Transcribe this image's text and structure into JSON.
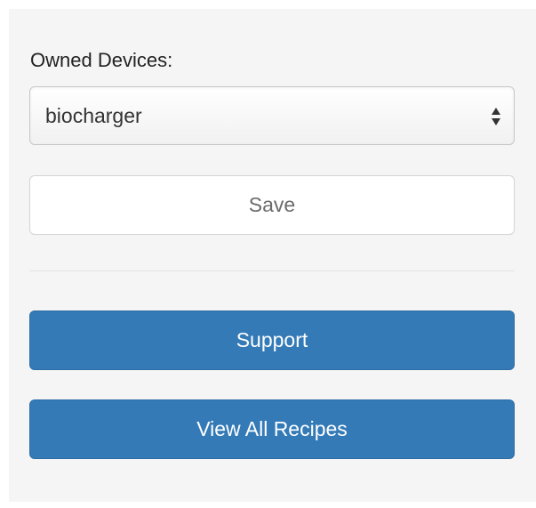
{
  "owned_devices": {
    "label": "Owned Devices:",
    "selected_value": "biocharger"
  },
  "buttons": {
    "save_label": "Save",
    "support_label": "Support",
    "view_all_recipes_label": "View All Recipes"
  },
  "colors": {
    "primary": "#337ab7",
    "panel_background": "#f5f5f5"
  }
}
